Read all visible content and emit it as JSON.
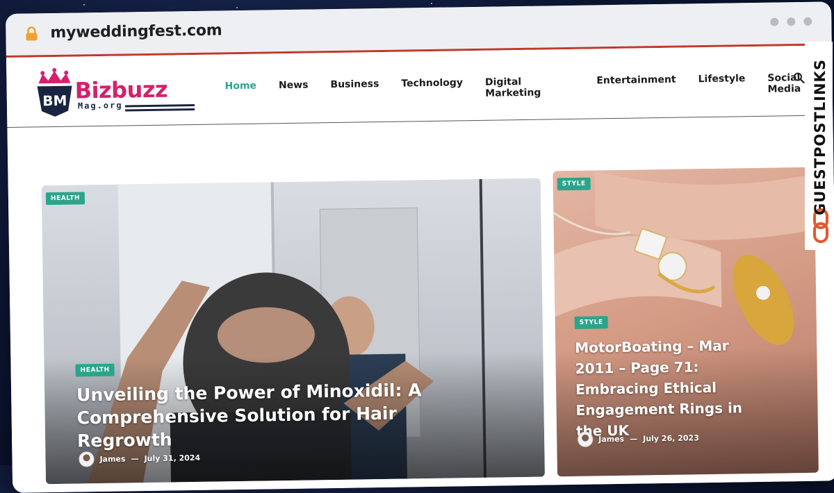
{
  "browser": {
    "url": "myweddingfest.com"
  },
  "site": {
    "logo": {
      "name": "Bizbuzz",
      "monogram": "BM",
      "domain": "Mag.org"
    },
    "nav": [
      {
        "label": "Home",
        "active": true
      },
      {
        "label": "News",
        "active": false
      },
      {
        "label": "Business",
        "active": false
      },
      {
        "label": "Technology",
        "active": false
      },
      {
        "label": "Digital Marketing",
        "active": false
      },
      {
        "label": "Entertainment",
        "active": false
      },
      {
        "label": "Lifestyle",
        "active": false
      },
      {
        "label": "Social Media",
        "active": false
      }
    ],
    "accent_color": "#2aa58b",
    "brand_color": "#d6206b"
  },
  "posts": {
    "main": {
      "corner_badge": "HEALTH",
      "badge": "HEALTH",
      "title": "Unveiling the Power of Minoxidil: A Comprehensive Solution for Hair Regrowth",
      "author": "James",
      "date": "July 31, 2024"
    },
    "side": {
      "corner_badge": "STYLE",
      "badge": "STYLE",
      "title": "MotorBoating – Mar 2011 – Page 71: Embracing Ethical Engagement Rings in the UK",
      "author": "James",
      "date": "July 26, 2023"
    }
  },
  "watermark": {
    "text": "GUESTPOSTLINKS"
  },
  "icons": {
    "lock": "lock-icon",
    "search": "search-icon"
  }
}
